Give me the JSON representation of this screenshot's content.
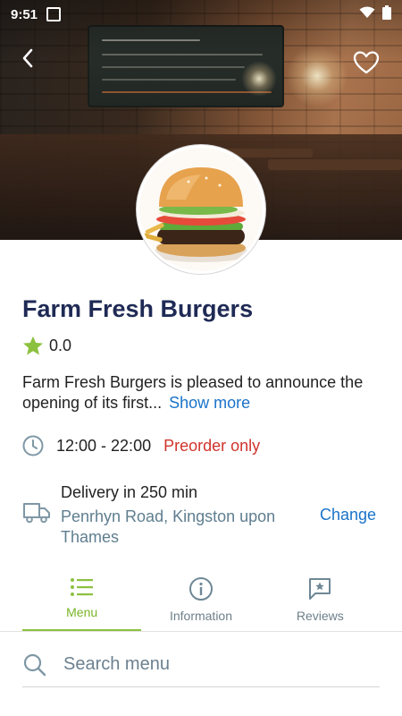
{
  "status_bar": {
    "time": "9:51"
  },
  "restaurant": {
    "name": "Farm Fresh Burgers",
    "rating": "0.0",
    "description": "Farm Fresh Burgers is pleased to announce the opening of its first...",
    "show_more_label": "Show more"
  },
  "hours": {
    "time_range": "12:00 - 22:00",
    "status": "Preorder only"
  },
  "delivery": {
    "eta": "Delivery in 250 min",
    "address": "Penrhyn Road, Kingston upon Thames",
    "change_label": "Change"
  },
  "tabs": [
    {
      "label": "Menu",
      "icon": "list-icon",
      "active": true
    },
    {
      "label": "Information",
      "icon": "info-icon",
      "active": false
    },
    {
      "label": "Reviews",
      "icon": "review-icon",
      "active": false
    }
  ],
  "search": {
    "placeholder": "Search menu"
  },
  "colors": {
    "accent": "#8cc13f",
    "title": "#1f2a55",
    "link": "#1a73c9",
    "warning": "#d0342c",
    "muted": "#5f7e8f"
  }
}
